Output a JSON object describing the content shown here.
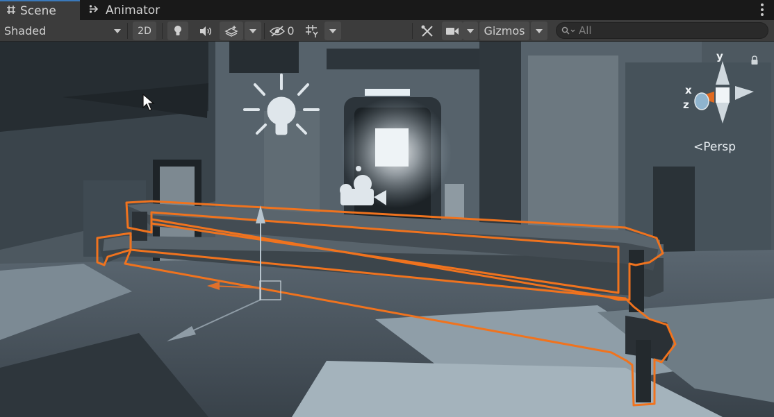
{
  "tabs": [
    {
      "label": "Scene",
      "icon": "grid-hash-icon",
      "active": true
    },
    {
      "label": "Animator",
      "icon": "animator-icon",
      "active": false
    }
  ],
  "toolbar": {
    "shading_mode": "Shaded",
    "mode_2d_label": "2D",
    "hidden_count": "0",
    "gizmos_label": "Gizmos",
    "search_placeholder": "All"
  },
  "scene": {
    "projection_label": "Persp",
    "axes": {
      "x": "x",
      "y": "y",
      "z": "z"
    }
  },
  "colors": {
    "selection_outline": "#f0731e",
    "tab_accent": "#3a79bb",
    "toolbar_bg": "#3c3c3c"
  }
}
